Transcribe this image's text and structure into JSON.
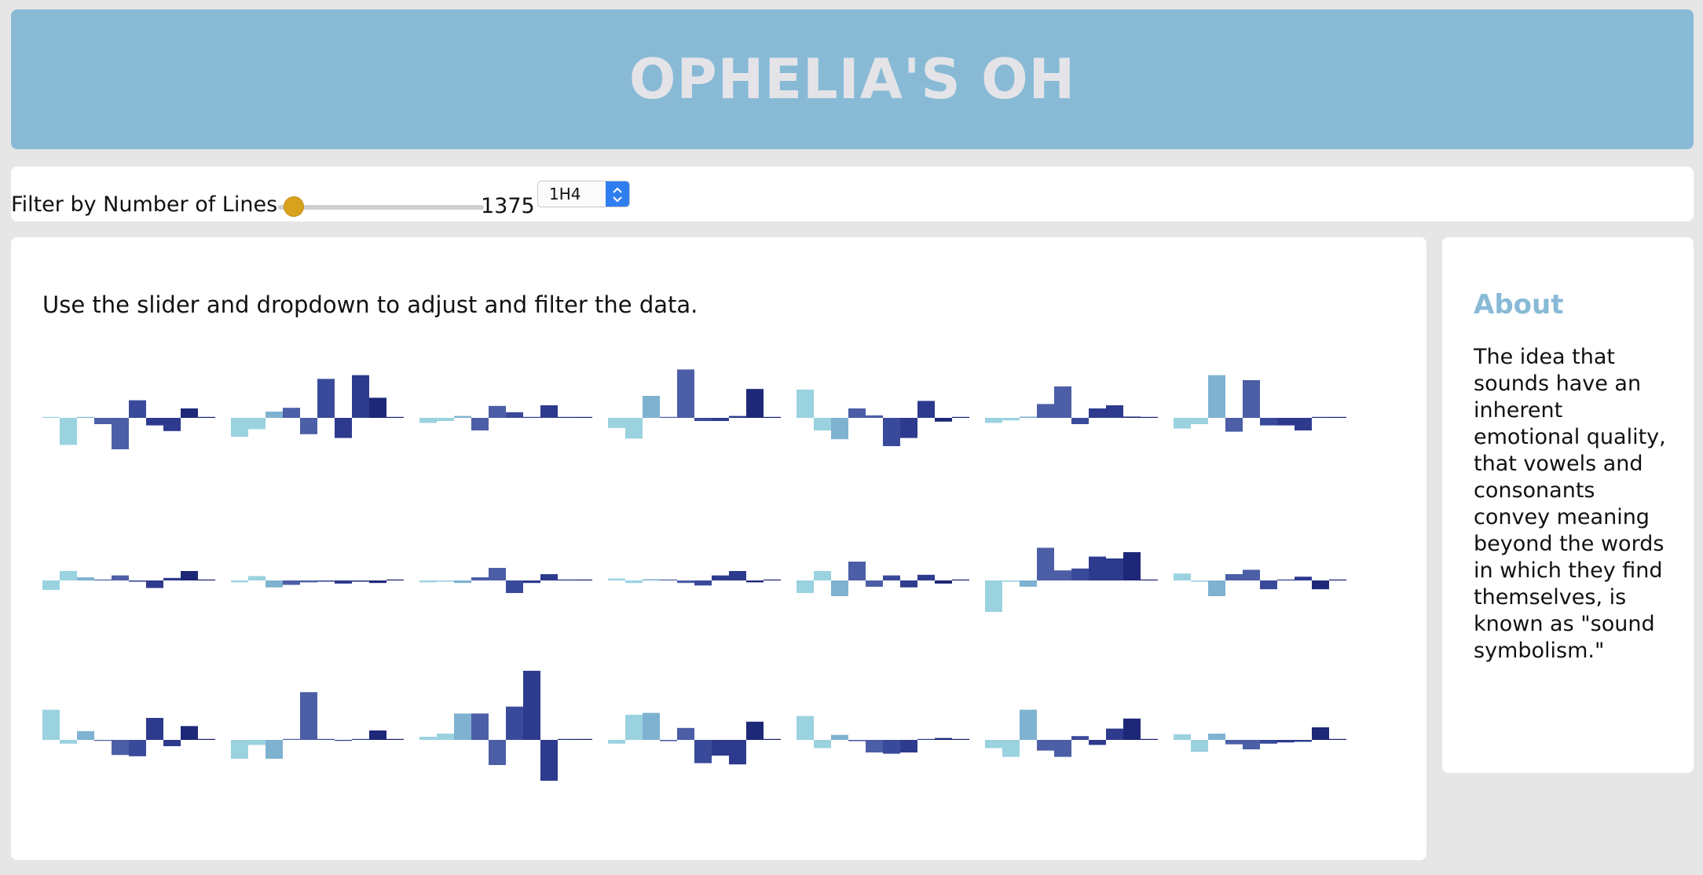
{
  "header": {
    "title": "OPHELIA'S OH"
  },
  "controls": {
    "filter_label": "Filter by Number of Lines",
    "slider_value": "1375",
    "slider_fraction": 0.03,
    "select_value": "1H4"
  },
  "main": {
    "instructions": "Use the slider and dropdown to adjust and filter the data."
  },
  "about": {
    "title": "About",
    "text": "The idea that sounds have an inherent emotional quality, that vowels and consonants convey meaning beyond the words in which they find themselves, is known as \"sound symbolism.\""
  },
  "colors": {
    "header_bg": "#88bad6",
    "header_text": "#e4e4e8",
    "slider_thumb": "#d8a21e",
    "bar_palette": [
      "#9ad2e0",
      "#7fb2d0",
      "#4b5ea6",
      "#3a4a9a",
      "#2e3a8e",
      "#1e2878",
      "#1a1f70"
    ]
  },
  "chart_data": {
    "type": "bar",
    "layout": "small-multiples grid, 3 rows x 7 columns, 10 bars each, centered on a zero baseline",
    "ylim": [
      -1,
      1
    ],
    "charts": [
      {
        "values": [
          0,
          -0.43,
          0,
          -0.1,
          -0.5,
          0.28,
          -0.12,
          -0.21,
          0.15,
          0
        ]
      },
      {
        "values": [
          -0.3,
          -0.18,
          0.1,
          0.16,
          -0.26,
          0.62,
          -0.32,
          0.68,
          0.32,
          0
        ]
      },
      {
        "values": [
          -0.08,
          -0.05,
          0.03,
          -0.2,
          0.19,
          0.09,
          0,
          0.2,
          0,
          0
        ]
      },
      {
        "values": [
          -0.16,
          -0.33,
          0.35,
          0,
          0.77,
          -0.05,
          -0.05,
          0.03,
          0.46,
          0
        ]
      },
      {
        "values": [
          0.45,
          -0.2,
          -0.34,
          0.15,
          0.04,
          -0.45,
          -0.32,
          0.27,
          -0.06,
          0
        ]
      },
      {
        "values": [
          -0.08,
          -0.04,
          0.02,
          0.22,
          0.5,
          -0.1,
          0.15,
          0.2,
          0.02,
          0
        ]
      },
      {
        "values": [
          -0.17,
          -0.1,
          0.68,
          -0.22,
          0.6,
          -0.12,
          -0.12,
          -0.2,
          0,
          0
        ]
      },
      {
        "values": [
          -0.15,
          0.15,
          0.05,
          0.01,
          0.08,
          -0.02,
          -0.12,
          0.04,
          0.15,
          0
        ]
      },
      {
        "values": [
          -0.03,
          0.07,
          -0.11,
          -0.07,
          -0.03,
          -0.02,
          -0.05,
          -0.02,
          -0.04,
          0
        ]
      },
      {
        "values": [
          -0.03,
          -0.02,
          -0.04,
          0.05,
          0.2,
          -0.2,
          -0.04,
          0.1,
          0,
          0
        ]
      },
      {
        "values": [
          0.03,
          -0.04,
          0.02,
          0,
          -0.04,
          -0.08,
          0.08,
          0.15,
          -0.03,
          0
        ]
      },
      {
        "values": [
          -0.2,
          0.15,
          -0.25,
          0.3,
          -0.1,
          0.08,
          -0.11,
          0.09,
          -0.05,
          0
        ]
      },
      {
        "values": [
          -0.5,
          -0.02,
          -0.1,
          0.52,
          0.16,
          0.19,
          0.38,
          0.35,
          0.45,
          0
        ]
      },
      {
        "values": [
          0.11,
          -0.02,
          -0.25,
          0.1,
          0.17,
          -0.14,
          0,
          0.06,
          -0.14,
          0
        ]
      },
      {
        "values": [
          0.48,
          -0.06,
          0.14,
          -0.01,
          -0.24,
          -0.26,
          0.35,
          -0.1,
          0.22,
          0
        ]
      },
      {
        "values": [
          -0.3,
          -0.08,
          -0.3,
          0,
          0.76,
          0,
          -0.01,
          0.01,
          0.15,
          0
        ]
      },
      {
        "values": [
          0.05,
          0.1,
          0.42,
          0.42,
          -0.4,
          0.53,
          1.1,
          -0.65,
          0,
          0
        ]
      },
      {
        "values": [
          -0.06,
          0.4,
          0.43,
          -0.02,
          0.19,
          -0.37,
          -0.25,
          -0.39,
          0.29,
          0
        ]
      },
      {
        "values": [
          0.38,
          -0.13,
          0.08,
          -0.02,
          -0.2,
          -0.22,
          -0.2,
          0,
          0.03,
          0
        ]
      },
      {
        "values": [
          -0.13,
          -0.27,
          0.48,
          -0.17,
          -0.27,
          0.06,
          -0.08,
          0.18,
          0.34,
          0
        ]
      },
      {
        "values": [
          0.09,
          -0.19,
          0.1,
          -0.07,
          -0.15,
          -0.06,
          -0.04,
          -0.03,
          0.2,
          0
        ]
      }
    ]
  }
}
